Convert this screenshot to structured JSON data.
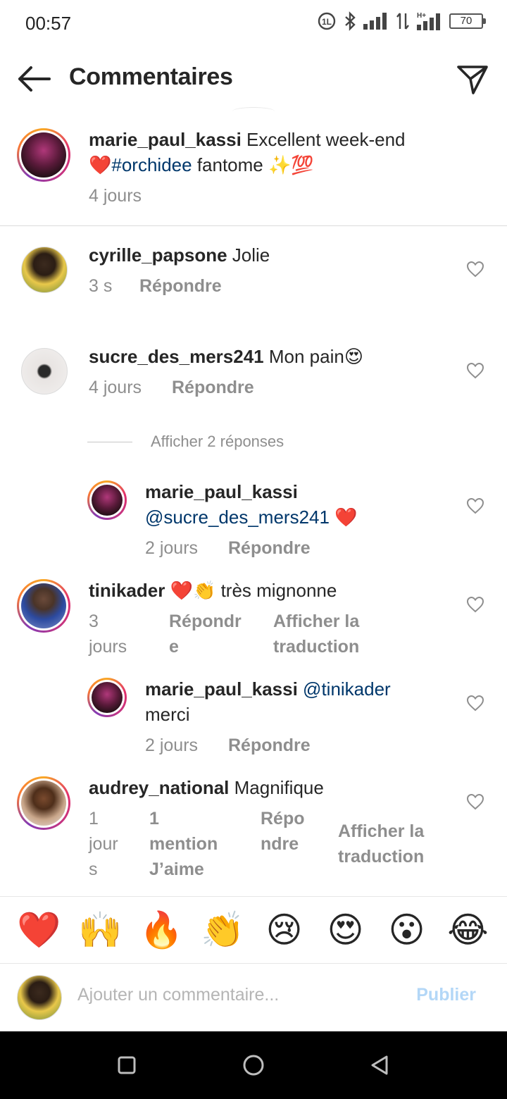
{
  "status": {
    "time": "00:57",
    "battery": "70"
  },
  "header": {
    "title": "Commentaires",
    "back_icon": "arrow-left-icon",
    "share_icon": "paper-plane-icon"
  },
  "caption": {
    "username": "marie_paul_kassi",
    "text_line1": "Excellent week-end",
    "emoji_heart": "❤️",
    "hashtag": "#orchidee",
    "text_line2": "fantome",
    "emoji_end": "✨💯",
    "time": "4 jours"
  },
  "comments": [
    {
      "username": "cyrille_papsone",
      "text": "Jolie",
      "time": "3 s",
      "reply": "Répondre"
    },
    {
      "username": "sucre_des_mers241",
      "text": "Mon pain😍",
      "time": "4 jours",
      "reply": "Répondre",
      "view_replies": "Afficher 2 réponses",
      "replies": [
        {
          "username": "marie_paul_kassi",
          "mention": "@sucre_des_mers241",
          "emoji": "❤️",
          "time": "2 jours",
          "reply": "Répondre"
        }
      ]
    },
    {
      "username": "tinikader",
      "text": "❤️👏 très mignonne",
      "time_line1": "3",
      "time_line2": "jours",
      "reply_line1": "Répondr",
      "reply_line2": "e",
      "translate_line1": "Afficher la",
      "translate_line2": "traduction",
      "replies": [
        {
          "username": "marie_paul_kassi",
          "mention": "@tinikader",
          "text": "merci",
          "time": "2 jours",
          "reply": "Répondre"
        }
      ]
    },
    {
      "username": "audrey_national",
      "text": "Magnifique",
      "time_line1": "1",
      "time_line2": "jour",
      "time_line3": "s",
      "likes_line1": "1",
      "likes_line2": "mention",
      "likes_line3": "J’aime",
      "reply_line1": "Répo",
      "reply_line2": "ndre",
      "translate_line1": "Afficher la",
      "translate_line2": "traduction"
    }
  ],
  "reactions": [
    "❤️",
    "🙌",
    "🔥",
    "👏",
    "😢",
    "😍",
    "😮",
    "😂"
  ],
  "composer": {
    "placeholder": "Ajouter un commentaire...",
    "publish": "Publier"
  },
  "colors": {
    "link": "#00376b",
    "meta": "#8e8e8e",
    "publish_disabled": "#b3d7f7"
  }
}
